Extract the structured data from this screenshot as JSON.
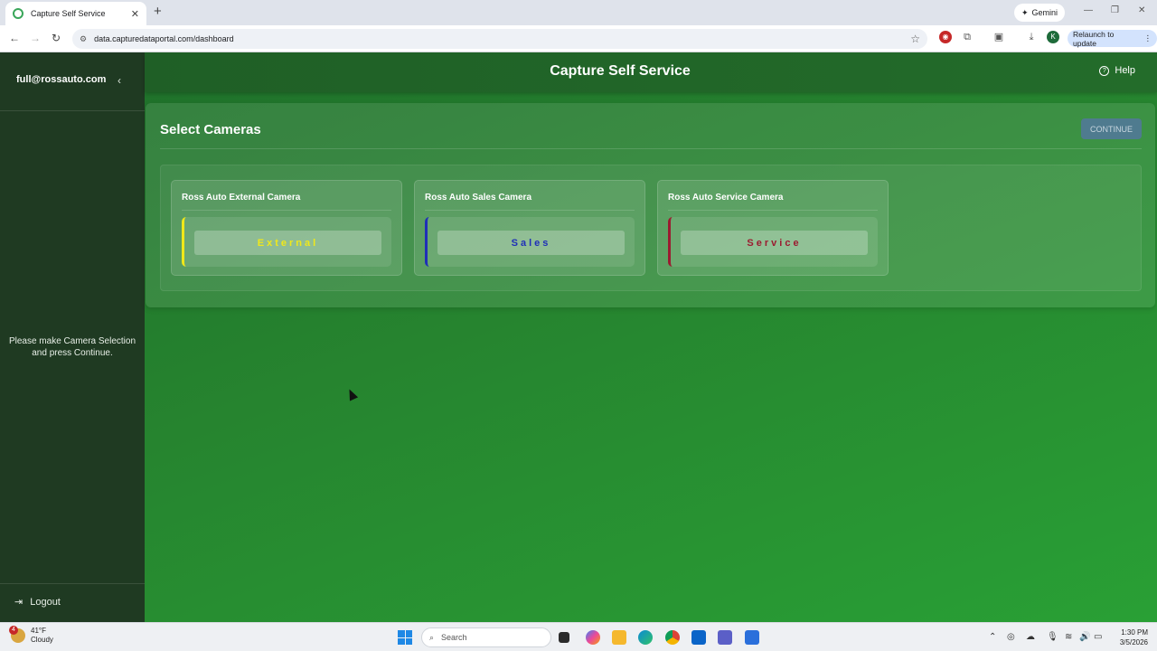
{
  "browser": {
    "tab_title": "Capture Self Service",
    "url": "data.capturedataportal.com/dashboard",
    "gemini_label": "Gemini",
    "relaunch_label": "Relaunch to update",
    "profile_initial": "K"
  },
  "sidebar": {
    "user_email": "full@rossauto.com",
    "message": "Please make Camera Selection and press Continue.",
    "logout_label": "Logout"
  },
  "header": {
    "title": "Capture Self Service",
    "help_label": "Help"
  },
  "main": {
    "panel_title": "Select Cameras",
    "continue_label": "CONTINUE",
    "cameras": [
      {
        "name": "Ross Auto External Camera",
        "option": "External",
        "color": "#f0e81a"
      },
      {
        "name": "Ross Auto Sales Camera",
        "option": "Sales",
        "color": "#1f2fb8"
      },
      {
        "name": "Ross Auto Service Camera",
        "option": "Service",
        "color": "#9b1b30"
      }
    ]
  },
  "taskbar": {
    "weather_temp": "41°F",
    "weather_desc": "Cloudy",
    "weather_badge": "4",
    "search_placeholder": "Search",
    "time": "1:30 PM",
    "date": "3/5/2026"
  }
}
